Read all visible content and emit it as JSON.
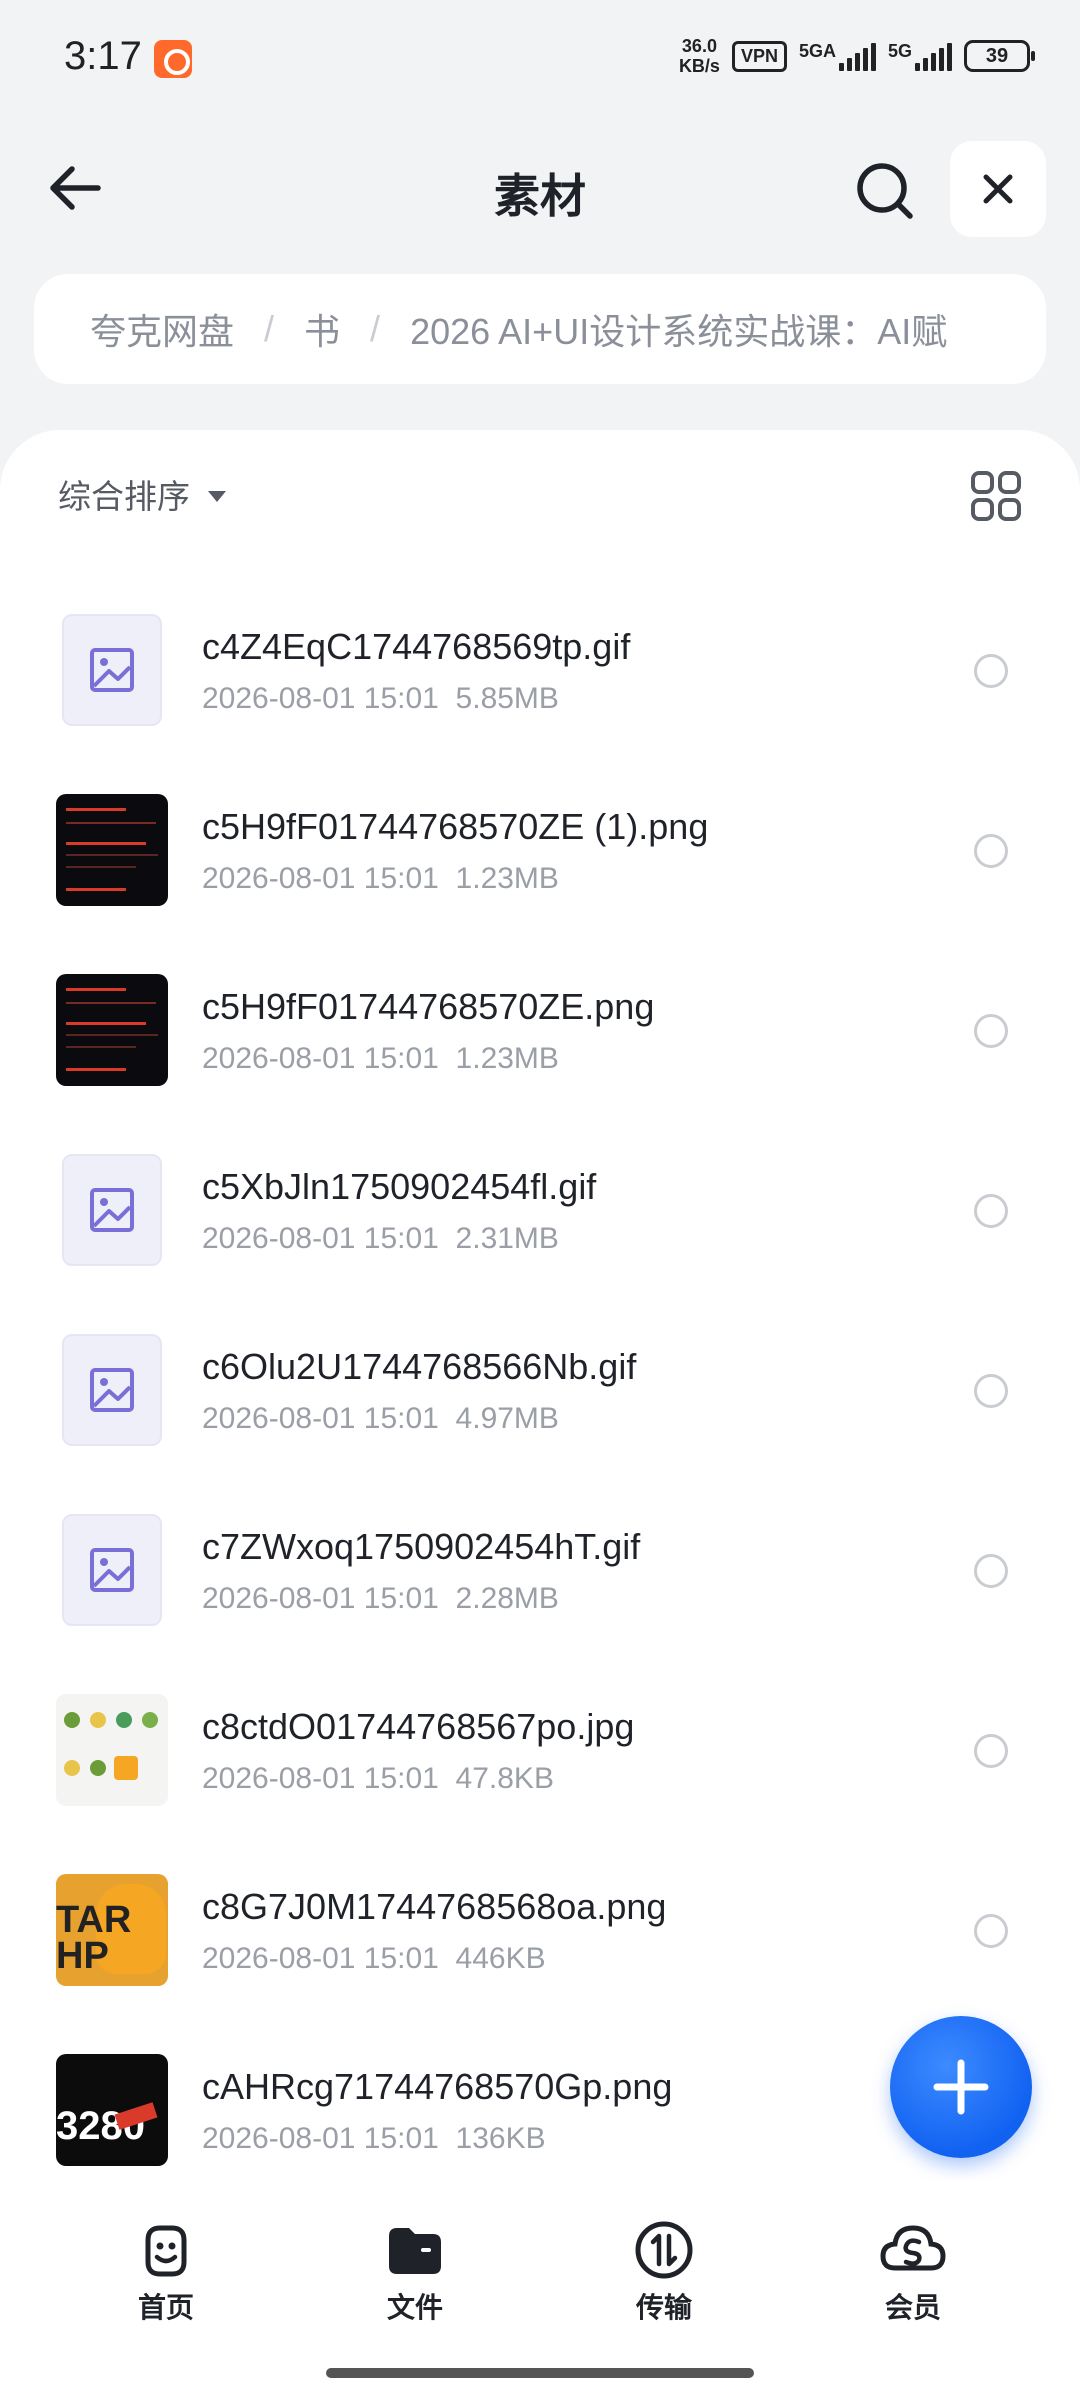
{
  "status_bar": {
    "time": "3:17",
    "net_speed_value": "36.0",
    "net_speed_unit": "KB/s",
    "vpn": "VPN",
    "signal1_label": "5GA",
    "signal2_label": "5G",
    "battery": "39"
  },
  "header": {
    "title": "素材"
  },
  "breadcrumb": {
    "items": [
      "夸克网盘",
      "书",
      "2026 AI+UI设计系统实战课：AI赋"
    ],
    "separator": "/"
  },
  "toolbar": {
    "sort_label": "综合排序"
  },
  "files": [
    {
      "name": "c4Z4EqC1744768569tp.gif",
      "date": "2026-08-01 15:01",
      "size": "5.85MB"
    },
    {
      "name": "c5H9fF01744768570ZE (1).png",
      "date": "2026-08-01 15:01",
      "size": "1.23MB"
    },
    {
      "name": "c5H9fF01744768570ZE.png",
      "date": "2026-08-01 15:01",
      "size": "1.23MB"
    },
    {
      "name": "c5XbJln1750902454fl.gif",
      "date": "2026-08-01 15:01",
      "size": "2.31MB"
    },
    {
      "name": "c6Olu2U1744768566Nb.gif",
      "date": "2026-08-01 15:01",
      "size": "4.97MB"
    },
    {
      "name": "c7ZWxoq1750902454hT.gif",
      "date": "2026-08-01 15:01",
      "size": "2.28MB"
    },
    {
      "name": "c8ctdO01744768567po.jpg",
      "date": "2026-08-01 15:01",
      "size": "47.8KB"
    },
    {
      "name": "c8G7J0M1744768568oa.png",
      "date": "2026-08-01 15:01",
      "size": "446KB"
    },
    {
      "name": "cAHRcg71744768570Gp.png",
      "date": "2026-08-01 15:01",
      "size": "136KB"
    }
  ],
  "thumbnails": {
    "orange_text": "TAR\nHP",
    "red_text": "3280"
  },
  "bottom_nav": [
    {
      "label": "首页",
      "icon": "smile-icon"
    },
    {
      "label": "文件",
      "icon": "folder-icon"
    },
    {
      "label": "传输",
      "icon": "transfer-icon"
    },
    {
      "label": "会员",
      "icon": "cloud-vip-icon"
    }
  ],
  "colors": {
    "accent": "#1262f2",
    "background": "#f2f3f5"
  }
}
